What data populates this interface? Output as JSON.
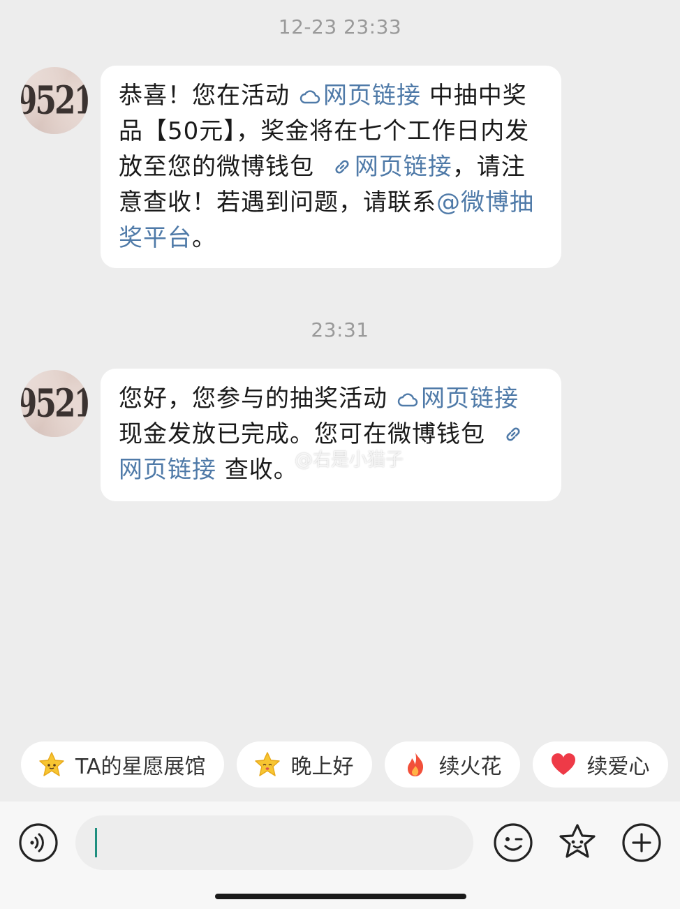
{
  "messages": [
    {
      "time": "12-23 23:33",
      "avatar_text": "9521",
      "parts": {
        "p1": "恭喜！您在活动",
        "link1": "网页链接",
        "p2": "中抽中奖品【50元】，奖金将在七个工作日内发放至您的微博钱包",
        "link2": "网页链接",
        "p3": "，请注意查收！若遇到问题，请联系",
        "mention": "@微博抽奖平台",
        "p4": "。"
      }
    },
    {
      "time": "23:31",
      "avatar_text": "9521",
      "parts": {
        "p1": "您好，您参与的抽奖活动",
        "link1": "网页链接",
        "p2": "现金发放已完成。您可在微博钱包",
        "link2": "网页链接",
        "p3": "查收。"
      }
    }
  ],
  "watermark": "@右是小猫子",
  "quick_replies": [
    {
      "label": "TA的星愿展馆",
      "icon": "star-face-icon"
    },
    {
      "label": "晚上好",
      "icon": "star-face-icon"
    },
    {
      "label": "续火花",
      "icon": "fire-icon"
    },
    {
      "label": "续爱心",
      "icon": "heart-icon"
    }
  ],
  "input": {
    "value": "",
    "placeholder": ""
  },
  "toolbar_icons": [
    "voice-icon",
    "emoji-icon",
    "sticker-star-icon",
    "plus-icon"
  ],
  "colors": {
    "link": "#4f7aa8",
    "background": "#ededed",
    "bubble": "#ffffff",
    "caret": "#1f8f7f"
  }
}
